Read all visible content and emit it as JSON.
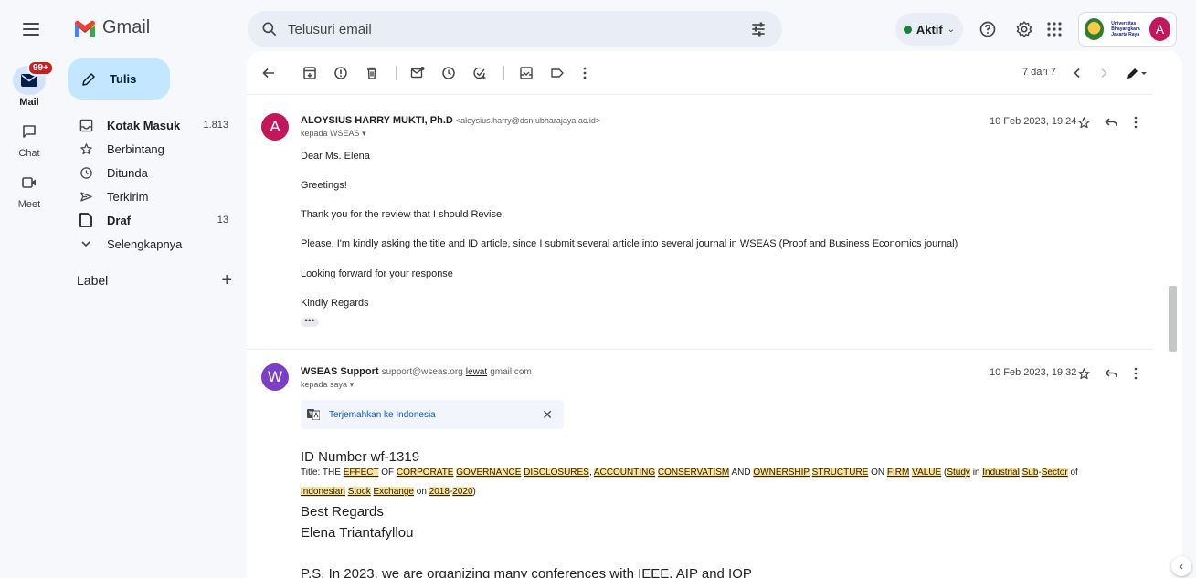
{
  "app": {
    "name": "Gmail"
  },
  "search": {
    "placeholder": "Telusuri email"
  },
  "status": {
    "label": "Aktif",
    "color": "#188038"
  },
  "account": {
    "org_text": "Universitas Bhayangkara Jakarta Raya",
    "avatar_letter": "A"
  },
  "rail": {
    "mail": {
      "label": "Mail",
      "badge": "99+"
    },
    "chat": {
      "label": "Chat"
    },
    "meet": {
      "label": "Meet"
    }
  },
  "compose": {
    "label": "Tulis"
  },
  "sidebar": {
    "items": [
      {
        "label": "Kotak Masuk",
        "count": "1.813",
        "icon": "inbox-icon",
        "bold": true
      },
      {
        "label": "Berbintang",
        "count": "",
        "icon": "star-icon",
        "bold": false
      },
      {
        "label": "Ditunda",
        "count": "",
        "icon": "clock-icon",
        "bold": false
      },
      {
        "label": "Terkirim",
        "count": "",
        "icon": "send-icon",
        "bold": false
      },
      {
        "label": "Draf",
        "count": "13",
        "icon": "draft-icon",
        "bold": true
      },
      {
        "label": "Selengkapnya",
        "count": "",
        "icon": "chevron-down-icon",
        "bold": false
      }
    ],
    "labels_heading": "Label"
  },
  "toolbar": {
    "pager": "7 dari 7"
  },
  "messages": [
    {
      "avatar_letter": "A",
      "avatar_color": "#c2185b",
      "sender_name": "ALOYSIUS HARRY MUKTI, Ph.D",
      "sender_email": "<aloysius.harry@dsn.ubharajaya.ac.id>",
      "recipient": "kepada WSEAS",
      "date": "10 Feb 2023, 19.24",
      "body": [
        "Dear Ms. Elena",
        "Greetings!",
        "Thank you for the review that I should Revise,",
        "Please, I'm kindly asking the title and ID article, since I submit several article into several journal in WSEAS (Proof and Business Economics journal)",
        "Looking forward for your response",
        "Kindly Regards"
      ],
      "ellipsis": "•••"
    },
    {
      "avatar_letter": "W",
      "avatar_color": "#7b3fc5",
      "sender_name": "WSEAS Support",
      "sender_email": "support@wseas.org",
      "via": "lewat",
      "via_domain": "gmail.com",
      "recipient": "kepada saya",
      "date": "10 Feb 2023, 19.32",
      "translate_label": "Terjemahkan ke Indonesia",
      "id_line": "ID Number wf-1319",
      "title_prefix": "Title:",
      "title_parts": [
        {
          "t": "THE",
          "h": false
        },
        {
          "t": "EFFECT",
          "h": true
        },
        {
          "t": "OF",
          "h": false
        },
        {
          "t": "CORPORATE",
          "h": true
        },
        {
          "t": "GOVERNANCE",
          "h": true
        },
        {
          "t": "DISCLOSURES",
          "h": true
        },
        {
          "t": ",",
          "h": false,
          "nospace": true
        },
        {
          "t": "ACCOUNTING",
          "h": true
        },
        {
          "t": "CONSERVATISM",
          "h": true
        },
        {
          "t": "AND",
          "h": false
        },
        {
          "t": "OWNERSHIP",
          "h": true
        },
        {
          "t": "STRUCTURE",
          "h": true
        },
        {
          "t": "ON",
          "h": false
        },
        {
          "t": "FIRM",
          "h": true
        },
        {
          "t": "VALUE",
          "h": true
        },
        {
          "t": "(",
          "h": false,
          "nospace_after": true
        },
        {
          "t": "Study",
          "h": true
        },
        {
          "t": "in",
          "h": false
        },
        {
          "t": "Industrial",
          "h": true
        },
        {
          "t": "Sub",
          "h": true
        },
        {
          "t": "-",
          "h": false,
          "nospace": true,
          "nospace_after": true
        },
        {
          "t": "Sector",
          "h": true
        },
        {
          "t": "of",
          "h": false
        }
      ],
      "title_parts_line2": [
        {
          "t": "Indonesian",
          "h": true
        },
        {
          "t": "Stock",
          "h": true
        },
        {
          "t": "Exchange",
          "h": true
        },
        {
          "t": "on",
          "h": false
        },
        {
          "t": "2018",
          "h": true
        },
        {
          "t": "-",
          "h": false,
          "nospace": true,
          "nospace_after": true
        },
        {
          "t": "2020",
          "h": true
        },
        {
          "t": ")",
          "h": false,
          "nospace": true
        }
      ],
      "regards": "Best Regards",
      "signature": "Elena Triantafyllou",
      "ps": "P.S. In 2023, we are organizing many conferences with IEEE, AIP and IOP"
    }
  ]
}
